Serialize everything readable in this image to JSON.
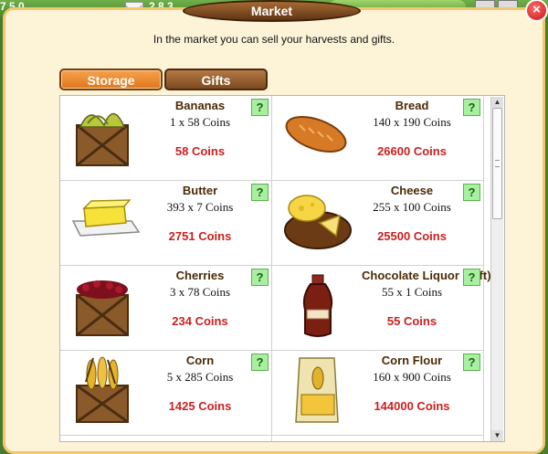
{
  "topbar": {
    "left_value": "7 5 0",
    "mid_value": "2 8 3"
  },
  "dialog": {
    "title": "Market",
    "description": "In the market you can sell your harvests and gifts.",
    "close_label": "×"
  },
  "tabs": [
    {
      "label": "Storage",
      "active": true
    },
    {
      "label": "Gifts",
      "active": false
    }
  ],
  "items": [
    {
      "name": "Bananas",
      "qty": "1 x 58 Coins",
      "coins": "58 Coins",
      "icon": "banana-crate-icon",
      "help": "?"
    },
    {
      "name": "Bread",
      "qty": "140 x 190 Coins",
      "coins": "26600 Coins",
      "icon": "bread-icon",
      "help": "?"
    },
    {
      "name": "Butter",
      "qty": "393 x 7 Coins",
      "coins": "2751 Coins",
      "icon": "butter-icon",
      "help": "?"
    },
    {
      "name": "Cheese",
      "qty": "255 x 100 Coins",
      "coins": "25500 Coins",
      "icon": "cheese-icon",
      "help": "?"
    },
    {
      "name": "Cherries",
      "qty": "3 x 78 Coins",
      "coins": "234 Coins",
      "icon": "cherry-crate-icon",
      "help": "?"
    },
    {
      "name": "Chocolate Liquor (Gift)",
      "qty": "55 x 1 Coins",
      "coins": "55 Coins",
      "icon": "chocolate-liquor-icon",
      "help": "?"
    },
    {
      "name": "Corn",
      "qty": "5 x 285 Coins",
      "coins": "1425 Coins",
      "icon": "corn-crate-icon",
      "help": "?"
    },
    {
      "name": "Corn Flour",
      "qty": "160 x 900 Coins",
      "coins": "144000 Coins",
      "icon": "corn-flour-icon",
      "help": "?"
    }
  ],
  "colors": {
    "accent_tab": "#e0761a",
    "coin_text": "#cc1f1f",
    "item_name": "#4b2a06"
  }
}
